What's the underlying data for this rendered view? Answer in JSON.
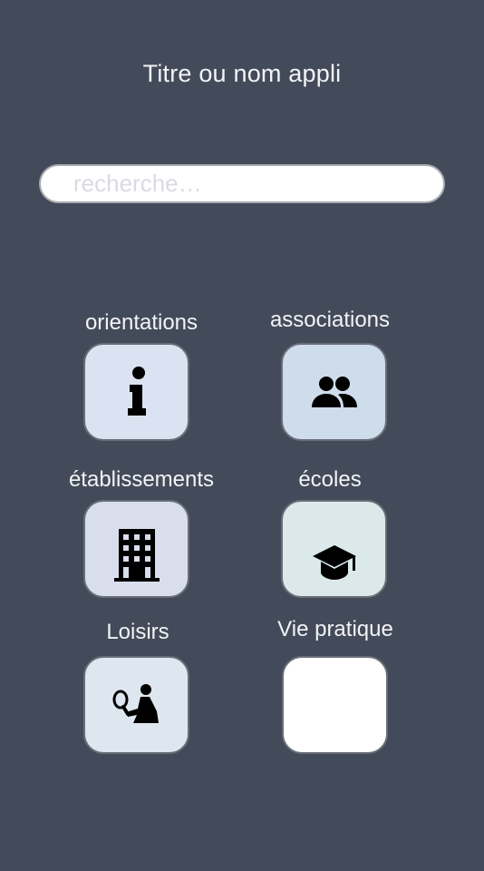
{
  "app": {
    "title": "Titre ou nom appli"
  },
  "search": {
    "placeholder": "recherche…",
    "value": ""
  },
  "categories": [
    {
      "label": "orientations",
      "icon": "info-icon",
      "color": "#dbe2f1"
    },
    {
      "label": "associations",
      "icon": "people-icon",
      "color": "#cedcec"
    },
    {
      "label": "établissements",
      "icon": "building-icon",
      "color": "#d9deec"
    },
    {
      "label": "écoles",
      "icon": "graduation-cap-icon",
      "color": "#dbe9ea"
    },
    {
      "label": "Loisirs",
      "icon": "tennis-player-icon",
      "color": "#dee6ef"
    },
    {
      "label": "Vie pratique",
      "icon": "",
      "color": "#ffffff"
    }
  ]
}
